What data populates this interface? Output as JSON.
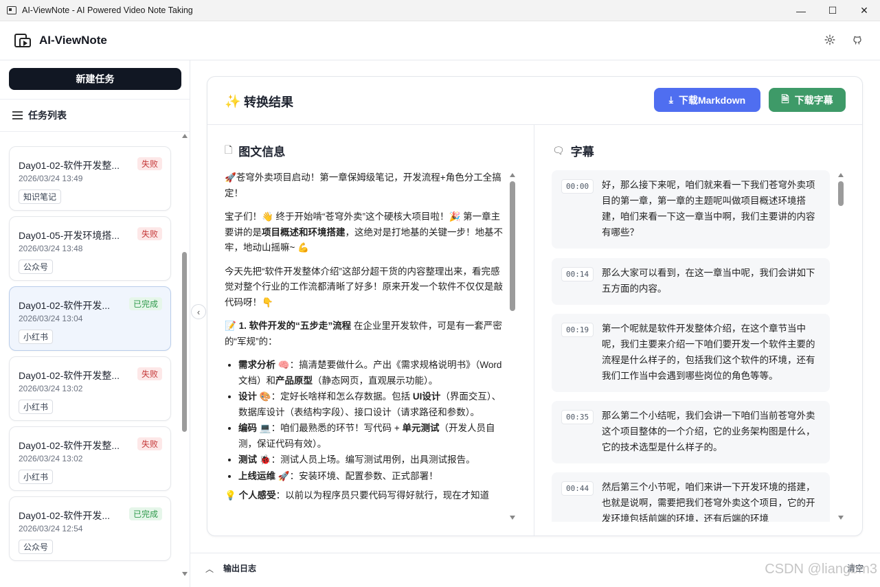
{
  "window": {
    "title": "AI-ViewNote - AI Powered Video Note Taking",
    "controls": {
      "minimize": "—",
      "maximize": "☐",
      "close": "✕"
    }
  },
  "header": {
    "app_name": "AI-ViewNote",
    "icons": [
      "gear-icon",
      "github-icon"
    ]
  },
  "sidebar": {
    "new_task_label": "新建任务",
    "list_title": "任务列表",
    "tasks": [
      {
        "title": "Day01-02-软件开发整...",
        "date": "2026/03/24 13:49",
        "status": "失败",
        "status_type": "fail",
        "tag": "知识笔记",
        "active": false
      },
      {
        "title": "Day01-05-开发环境搭...",
        "date": "2026/03/24 13:48",
        "status": "失败",
        "status_type": "fail",
        "tag": "公众号",
        "active": false
      },
      {
        "title": "Day01-02-软件开发...",
        "date": "2026/03/24 13:04",
        "status": "已完成",
        "status_type": "done",
        "tag": "小红书",
        "active": true
      },
      {
        "title": "Day01-02-软件开发整...",
        "date": "2026/03/24 13:02",
        "status": "失败",
        "status_type": "fail",
        "tag": "小红书",
        "active": false
      },
      {
        "title": "Day01-02-软件开发整...",
        "date": "2026/03/24 13:02",
        "status": "失败",
        "status_type": "fail",
        "tag": "小红书",
        "active": false
      },
      {
        "title": "Day01-02-软件开发...",
        "date": "2026/03/24 12:54",
        "status": "已完成",
        "status_type": "done",
        "tag": "公众号",
        "active": false
      }
    ]
  },
  "result": {
    "title": "转换结果",
    "download_markdown": "下载Markdown",
    "download_subtitles": "下载字幕",
    "left_title": "图文信息",
    "right_title": "字幕",
    "article": {
      "p1_emoji": "🚀",
      "p1": "苍穹外卖项目启动！第一章保姆级笔记，开发流程+角色分工全搞定！",
      "p2_a": "宝子们！👋 终于开始啃“苍穹外卖”这个硬核大项目啦！🎉 第一章主要讲的是",
      "p2_b": "项目概述和环境搭建",
      "p2_c": "，这绝对是打地基的关键一步！地基不牢，地动山摇嘛~ 💪",
      "p3": "今天先把“软件开发整体介绍”这部分超干货的内容整理出来，看完感觉对整个行业的工作流都清晰了好多！原来开发一个软件不仅仅是敲代码呀！👇",
      "p4_emoji": "📝",
      "p4_b": "1. 软件开发的“五步走”流程",
      "p4_c": " 在企业里开发软件，可是有一套严密的“军规”的：",
      "steps": [
        {
          "name": "需求分析",
          "emoji": "🧠",
          "text_a": "：搞清楚要做什么。产出《需求规格说明书》（Word文档）和",
          "bold": "产品原型",
          "text_b": "（静态网页，直观展示功能）。"
        },
        {
          "name": "设计",
          "emoji": "🎨",
          "text_a": "：定好长啥样和怎么存数据。包括 ",
          "bold": "UI设计",
          "text_b": "（界面交互）、数据库设计（表结构字段）、接口设计（请求路径和参数）。"
        },
        {
          "name": "编码",
          "emoji": "💻",
          "text_a": "：咱们最熟悉的环节！写代码 + ",
          "bold": "单元测试",
          "text_b": "（开发人员自测，保证代码有效）。"
        },
        {
          "name": "测试",
          "emoji": "🐞",
          "text_a": "：测试人员上场。编写测试用例，出具测试报告。",
          "bold": "",
          "text_b": ""
        },
        {
          "name": "上线运维",
          "emoji": "🚀",
          "text_a": "：安装环境、配置参数、正式部署！",
          "bold": "",
          "text_b": ""
        }
      ],
      "p5_emoji": "💡",
      "p5_b": "个人感受",
      "p5_c": "：以前以为程序员只要代码写得好就行，现在才知道"
    },
    "subtitles": [
      {
        "time": "00:00",
        "text": "好，那么接下来呢，咱们就来看一下我们苍穹外卖项目的第一章，第一章的主题呢叫做项目概述环境搭建，咱们来看一下这一章当中啊，我们主要讲的内容有哪些？"
      },
      {
        "time": "00:14",
        "text": "那么大家可以看到，在这一章当中呢，我们会讲如下五方面的内容。"
      },
      {
        "time": "00:19",
        "text": "第一个呢就是软件开发整体介绍，在这个章节当中呢，我们主要来介绍一下咱们要开发一个软件主要的流程是什么样子的，包括我们这个软件的环境，还有我们工作当中会遇到哪些岗位的角色等等。"
      },
      {
        "time": "00:35",
        "text": "那么第二个小结呢，我们会讲一下咱们当前苍穹外卖这个项目整体的一个介绍，它的业务架构图是什么，它的技术选型是什么样子的。"
      },
      {
        "time": "00:44",
        "text": "然后第三个小节呢，咱们来讲一下开发环境的搭建，也就是说啊，需要把我们苍穹外卖这个项目，它的开发环境包括前端的环境，还有后端的环境"
      }
    ]
  },
  "footer": {
    "log_label": "输出日志",
    "clear_label": "清空"
  },
  "watermark": "CSDN @liangbm3",
  "colors": {
    "primary_blue": "#4f6ef0",
    "success_green": "#3e9a68",
    "dark_button": "#111723",
    "fail_badge": "#c53a3a",
    "done_badge": "#2f9a4c"
  }
}
